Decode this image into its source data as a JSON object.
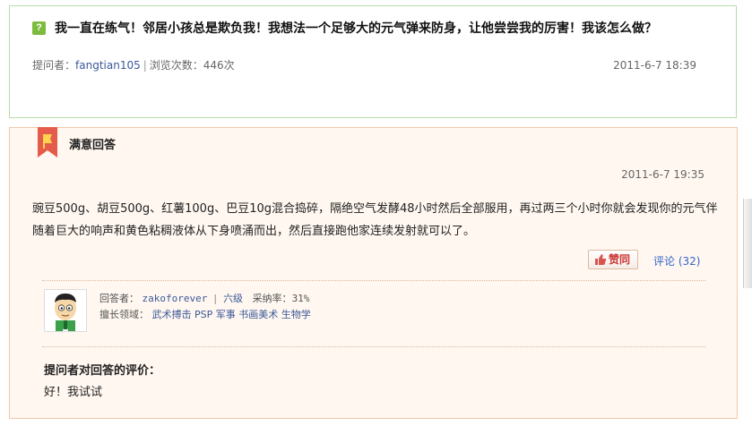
{
  "question": {
    "icon_glyph": "?",
    "title": "我一直在练气！邻居小孩总是欺负我！我想法一个足够大的元气弹来防身，让他尝尝我的厉害！我该怎么做？",
    "asker_label": "提问者：",
    "asker_name": "fangtian105",
    "views": "浏览次数：446次",
    "date": "2011-6-7 18:39"
  },
  "answer": {
    "header": "满意回答",
    "date": "2011-6-7 19:35",
    "body": "豌豆500g、胡豆500g、红薯100g、巴豆10g混合捣碎，隔绝空气发酵48小时然后全部服用，再过两三个小时你就会发现你的元气伴随着巨大的响声和黄色粘稠液体从下身喷涌而出，然后直接跑他家连续发射就可以了。",
    "agree_label": "赞同",
    "comment_label": "评论",
    "comment_count": "(32)"
  },
  "answerer": {
    "label": "回答者：",
    "name": "zakoforever",
    "level": "六级",
    "rate_label": "采纳率：",
    "rate": "31%",
    "expertise_label": "擅长领域：",
    "expertise": [
      "武术搏击",
      "PSP",
      "军事",
      "书画美术",
      "生物学"
    ]
  },
  "evaluation": {
    "title": "提问者对回答的评价：",
    "text": "好！我试试"
  },
  "colors": {
    "question_border": "#b9dda6",
    "answer_border": "#f3c9a9",
    "answer_bg": "#fff7f0",
    "link": "#3b5998"
  }
}
